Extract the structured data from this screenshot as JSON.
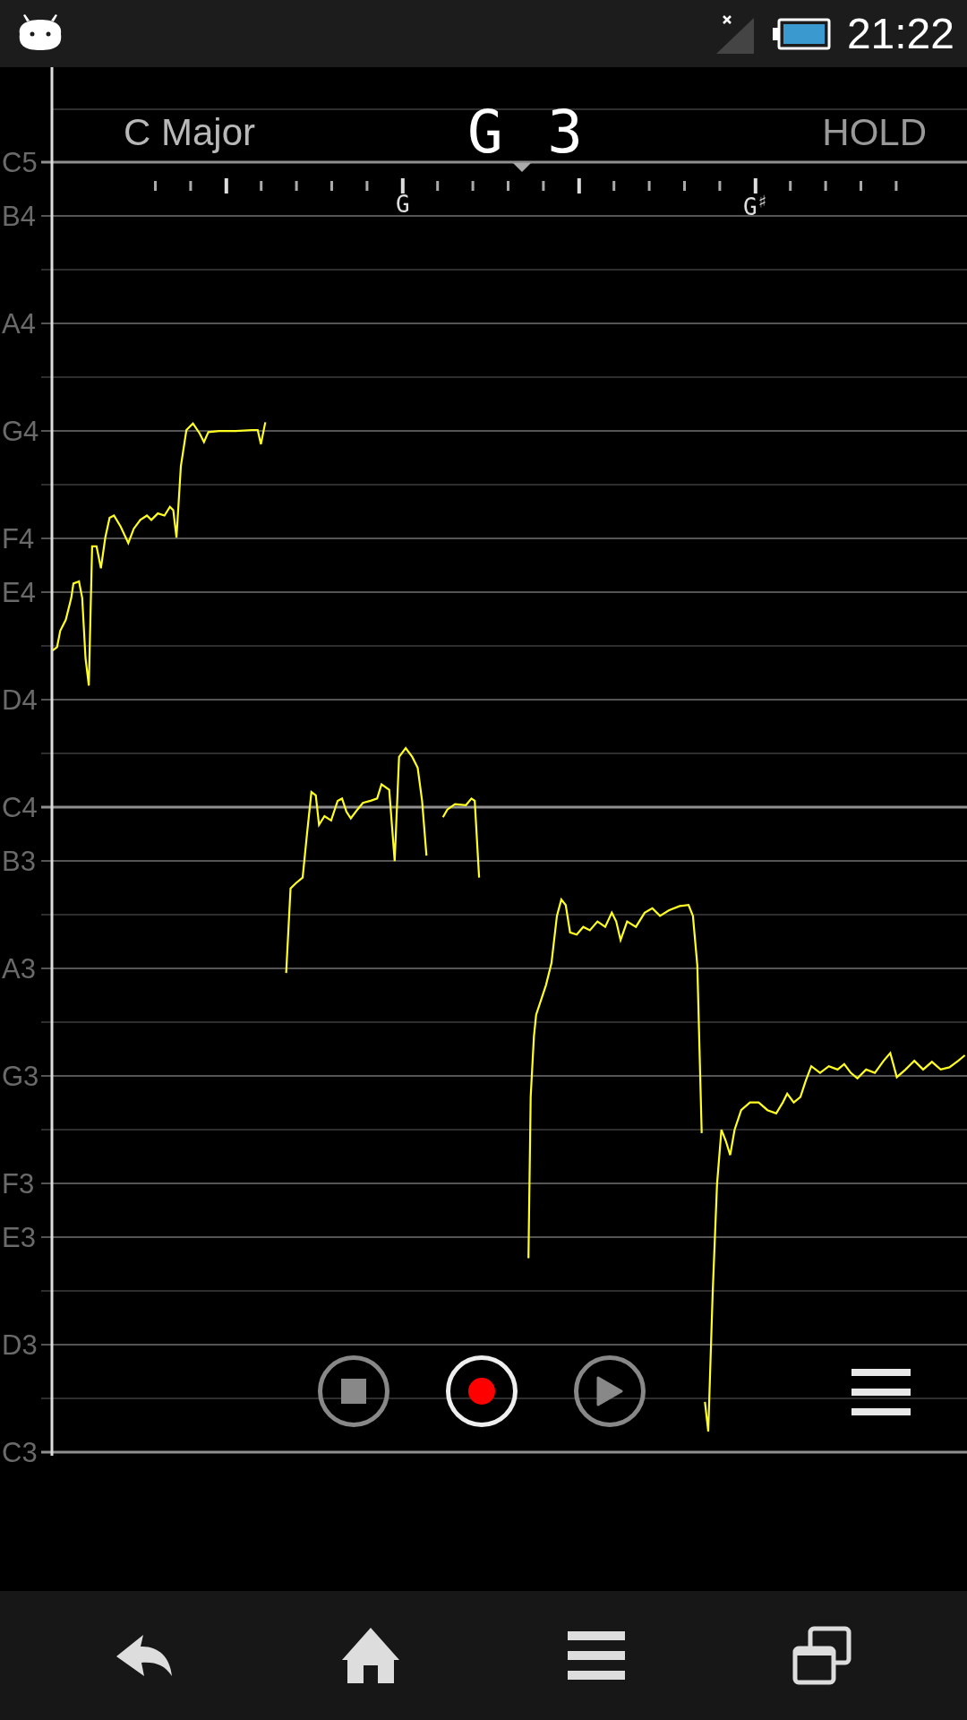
{
  "status_bar": {
    "time": "21:22"
  },
  "header": {
    "scale": "C Major",
    "note": "G 3",
    "hold": "HOLD"
  },
  "ruler": {
    "labels": [
      {
        "text": "G"
      },
      {
        "text": "G$^{♯}$"
      }
    ]
  },
  "staff": [
    {
      "kind": "octave",
      "label": "C5"
    },
    {
      "kind": "natural",
      "label": "B4"
    },
    {
      "kind": "sharp"
    },
    {
      "kind": "natural",
      "label": "A4"
    },
    {
      "kind": "sharp"
    },
    {
      "kind": "natural",
      "label": "G4"
    },
    {
      "kind": "sharp"
    },
    {
      "kind": "natural",
      "label": "F4"
    },
    {
      "kind": "natural",
      "label": "E4"
    },
    {
      "kind": "sharp"
    },
    {
      "kind": "natural",
      "label": "D4"
    },
    {
      "kind": "sharp"
    },
    {
      "kind": "octave",
      "label": "C4"
    },
    {
      "kind": "natural",
      "label": "B3"
    },
    {
      "kind": "sharp"
    },
    {
      "kind": "natural",
      "label": "A3"
    },
    {
      "kind": "sharp"
    },
    {
      "kind": "natural",
      "label": "G3"
    },
    {
      "kind": "sharp"
    },
    {
      "kind": "natural",
      "label": "F3"
    },
    {
      "kind": "natural",
      "label": "E3"
    },
    {
      "kind": "sharp"
    },
    {
      "kind": "natural",
      "label": "D3"
    },
    {
      "kind": "sharp"
    },
    {
      "kind": "octave",
      "label": "C3"
    }
  ],
  "controls": [
    {
      "kind": "stop",
      "selected": false
    },
    {
      "kind": "record",
      "selected": true
    },
    {
      "kind": "play",
      "selected": false
    }
  ]
}
